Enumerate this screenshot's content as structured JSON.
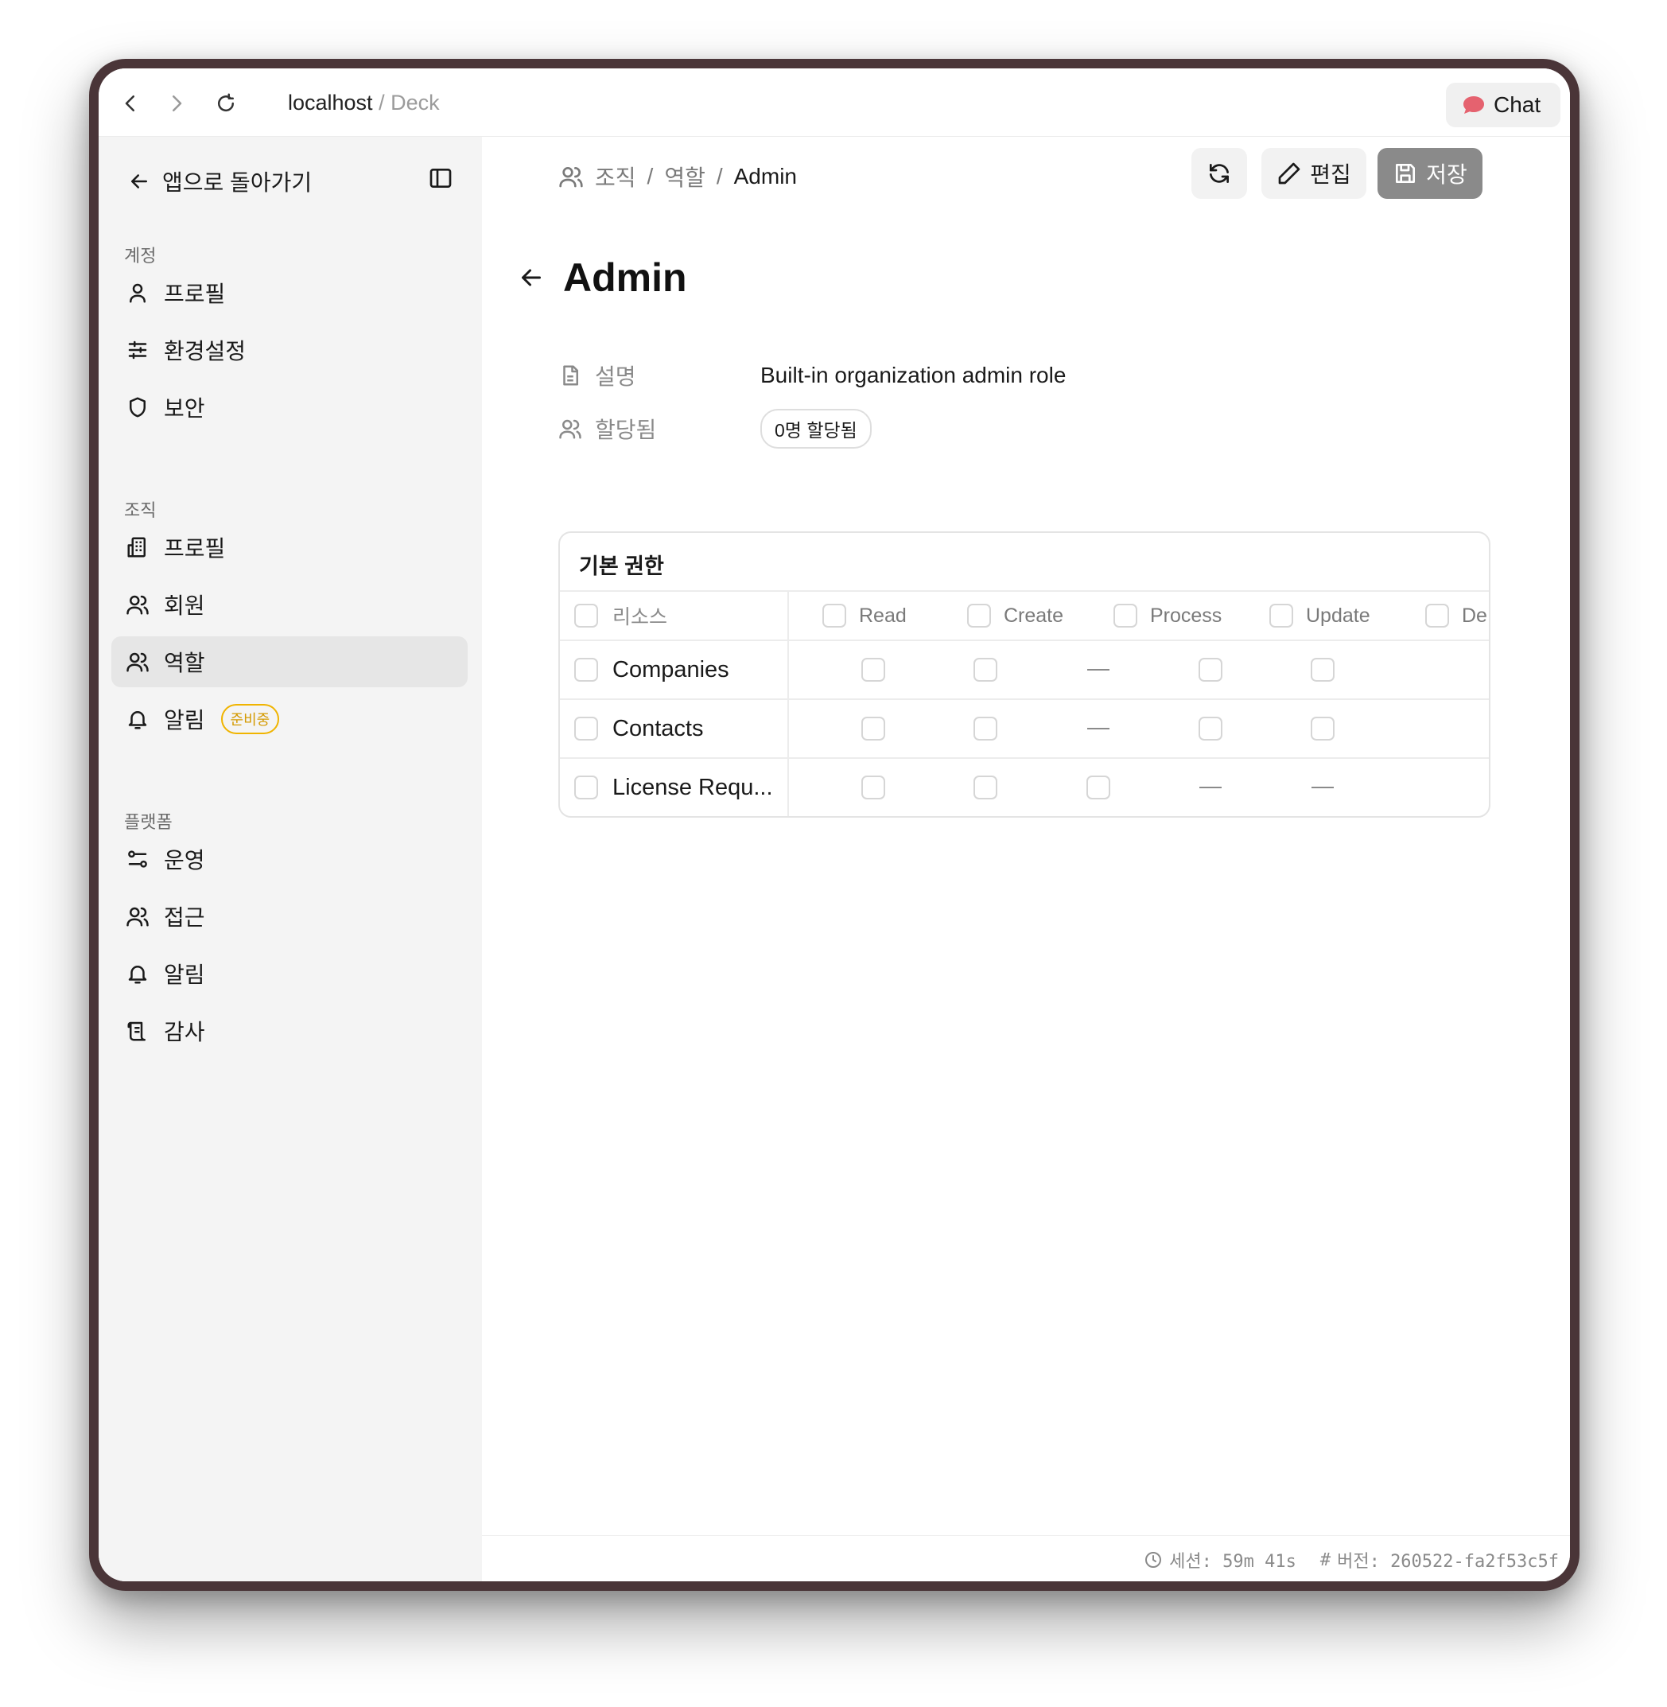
{
  "browser": {
    "host": "localhost",
    "separator": " / ",
    "path": "Deck",
    "chat_label": "Chat",
    "chat_color": "#e5626f"
  },
  "sidebar": {
    "back_label": "앱으로 돌아가기",
    "sections": {
      "account": "계정",
      "org": "조직",
      "platform": "플랫폼"
    },
    "account_items": [
      "프로필",
      "환경설정",
      "보안"
    ],
    "org_items": [
      "프로필",
      "회원",
      "역할",
      "알림"
    ],
    "org_badge": "준비중",
    "platform_items": [
      "운영",
      "접근",
      "알림",
      "감사"
    ]
  },
  "header": {
    "breadcrumb": [
      "조직",
      "역할",
      "Admin"
    ],
    "edit_label": "편집",
    "save_label": "저장"
  },
  "page": {
    "title": "Admin",
    "description_label": "설명",
    "description_value": "Built-in organization admin role",
    "assigned_label": "할당됨",
    "assigned_value": "0명 할당됨"
  },
  "permissions": {
    "title": "기본 권한",
    "resource_header": "리소스",
    "columns": [
      "Read",
      "Create",
      "Process",
      "Update",
      "De"
    ],
    "rows": [
      {
        "name": "Companies",
        "cells": [
          "box",
          "box",
          "dash",
          "box",
          "box"
        ]
      },
      {
        "name": "Contacts",
        "cells": [
          "box",
          "box",
          "dash",
          "box",
          "box"
        ]
      },
      {
        "name": "License Requ...",
        "cells": [
          "box",
          "box",
          "box",
          "dash",
          "dash"
        ]
      }
    ]
  },
  "footer": {
    "session": "세션: 59m 41s",
    "version": "버전: 260522-fa2f53c5f"
  }
}
